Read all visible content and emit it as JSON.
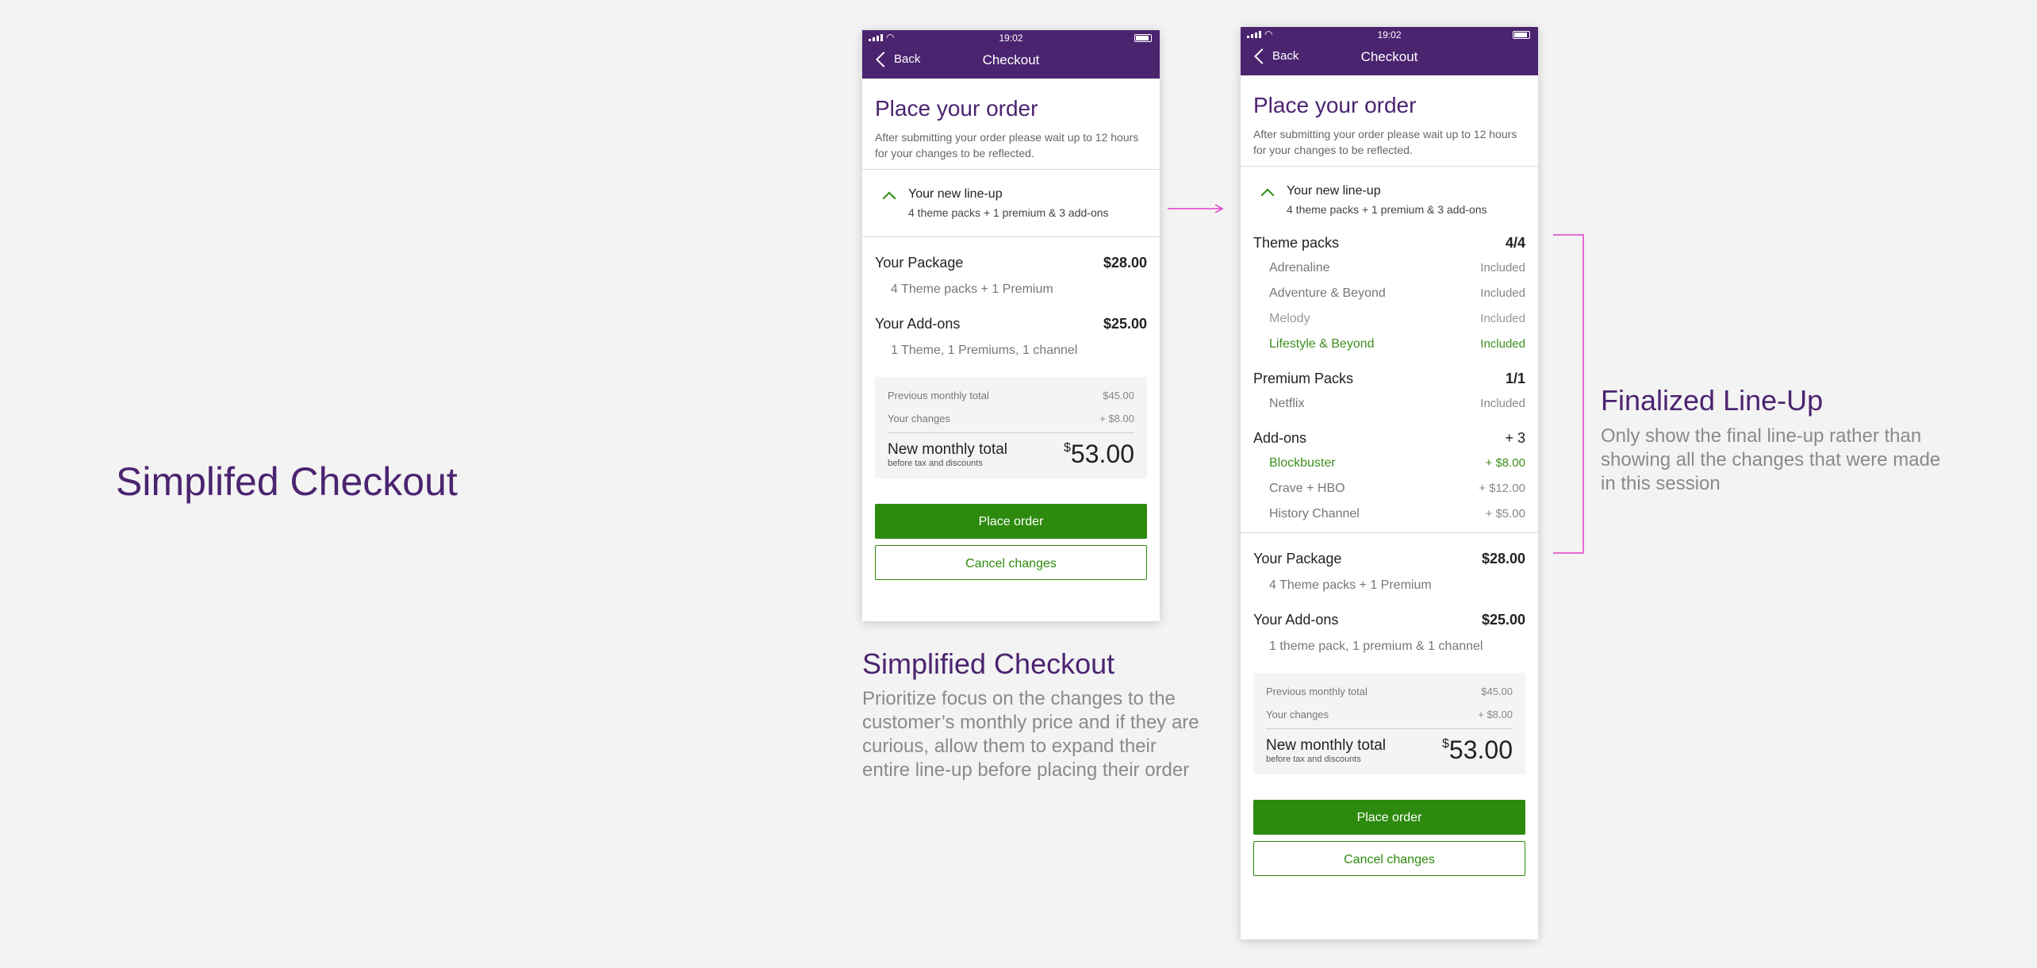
{
  "page": {
    "title": "Simplifed Checkout"
  },
  "colors": {
    "brand": "#4b2470",
    "accent_green": "#2d8a0e",
    "annotation_magenta": "#e040c8"
  },
  "status_bar": {
    "time": "19:02"
  },
  "nav": {
    "back_label": "Back",
    "title": "Checkout"
  },
  "checkout": {
    "heading": "Place your order",
    "subtext_line1": "After submitting your order please wait up to 12 hours",
    "subtext_line2": "for your changes to be reflected.",
    "lineup_title": "Your new line-up",
    "lineup_summary": "4 theme packs + 1 premium & 3 add-ons"
  },
  "screen_a": {
    "package": {
      "label": "Your Package",
      "price": "$28.00",
      "detail": "4 Theme packs + 1 Premium"
    },
    "addons": {
      "label": "Your Add-ons",
      "price": "$25.00",
      "detail": "1 Theme, 1 Premiums, 1 channel"
    },
    "totals": {
      "previous_label": "Previous monthly total",
      "previous_value": "$45.00",
      "changes_label": "Your changes",
      "changes_value": "+ $8.00",
      "new_label": "New monthly total",
      "new_sub": "before tax and discounts",
      "currency": "$",
      "new_value": "53.00"
    },
    "place_order": "Place order",
    "cancel": "Cancel changes"
  },
  "screen_b": {
    "theme_packs": {
      "label": "Theme packs",
      "count": "4/4",
      "items": [
        {
          "name": "Adrenaline",
          "value": "Included"
        },
        {
          "name": "Adventure & Beyond",
          "value": "Included"
        },
        {
          "name": "Melody",
          "value": "Included"
        },
        {
          "name": "Lifestyle & Beyond",
          "value": "Included"
        }
      ]
    },
    "premium_packs": {
      "label": "Premium Packs",
      "count": "1/1",
      "items": [
        {
          "name": "Netflix",
          "value": "Included"
        }
      ]
    },
    "addons_list": {
      "label": "Add-ons",
      "count": "+ 3",
      "items": [
        {
          "name": "Blockbuster",
          "value": "+ $8.00"
        },
        {
          "name": "Crave + HBO",
          "value": "+ $12.00"
        },
        {
          "name": "History Channel",
          "value": "+ $5.00"
        }
      ]
    },
    "package": {
      "label": "Your Package",
      "price": "$28.00",
      "detail": "4 Theme packs + 1 Premium"
    },
    "addons": {
      "label": "Your Add-ons",
      "price": "$25.00",
      "detail": "1 theme pack, 1 premium & 1 channel"
    },
    "totals": {
      "previous_label": "Previous monthly total",
      "previous_value": "$45.00",
      "changes_label": "Your changes",
      "changes_value": "+ $8.00",
      "new_label": "New monthly total",
      "new_sub": "before tax and discounts",
      "currency": "$",
      "new_value": "53.00"
    },
    "place_order": "Place order",
    "cancel": "Cancel changes"
  },
  "captions": {
    "simplified": {
      "title": "Simplified Checkout",
      "line1": "Prioritize focus on the changes to the",
      "line2": "customer’s monthly price and if they are",
      "line3": "curious, allow them to expand their",
      "line4": "entire line-up before placing their order"
    },
    "finalized": {
      "title": "Finalized Line-Up",
      "line1": "Only show the final line-up rather than",
      "line2": "showing all the changes that were made",
      "line3": "in this session"
    }
  }
}
